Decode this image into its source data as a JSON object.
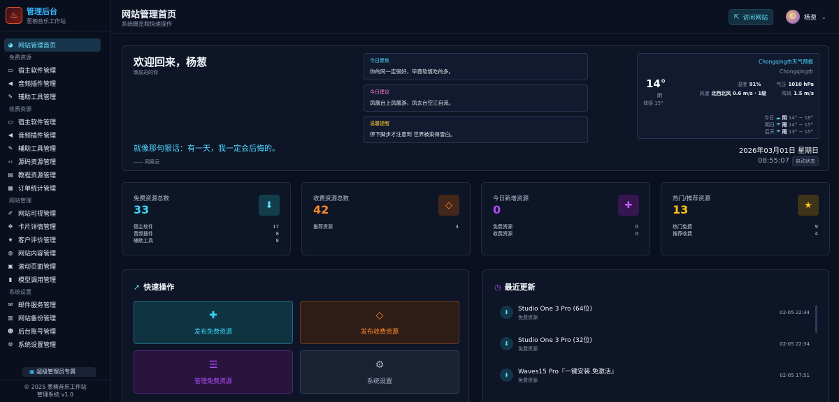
{
  "brand": {
    "title": "管理后台",
    "subtitle": "葱楠音乐工作站"
  },
  "sidebar": {
    "home": "网站管理首页",
    "sections": [
      {
        "label": "免费资源",
        "items": [
          {
            "label": "宿主软件管理",
            "icon": "monitor-icon"
          },
          {
            "label": "音频插件管理",
            "icon": "volume-icon"
          },
          {
            "label": "辅助工具管理",
            "icon": "wrench-icon"
          }
        ]
      },
      {
        "label": "收费资源",
        "items": [
          {
            "label": "宿主软件管理",
            "icon": "monitor-icon"
          },
          {
            "label": "音频插件管理",
            "icon": "volume-icon"
          },
          {
            "label": "辅助工具管理",
            "icon": "wrench-icon"
          },
          {
            "label": "源码资源管理",
            "icon": "code-icon"
          },
          {
            "label": "教程资源管理",
            "icon": "book-icon"
          },
          {
            "label": "订单统计管理",
            "icon": "cart-icon"
          }
        ]
      },
      {
        "label": "网站管理",
        "items": [
          {
            "label": "网站可视管理",
            "icon": "edit-icon"
          },
          {
            "label": "卡片详情管理",
            "icon": "cards-icon"
          },
          {
            "label": "客户评价管理",
            "icon": "star-icon"
          },
          {
            "label": "网站内容管理",
            "icon": "globe-icon"
          },
          {
            "label": "滚动页面管理",
            "icon": "image-icon"
          },
          {
            "label": "模型调用管理",
            "icon": "model-icon"
          }
        ]
      },
      {
        "label": "系统设置",
        "items": [
          {
            "label": "邮件服务管理",
            "icon": "mail-icon"
          },
          {
            "label": "网站备份管理",
            "icon": "backup-icon"
          },
          {
            "label": "后台账号管理",
            "icon": "users-icon"
          },
          {
            "label": "系统设置管理",
            "icon": "gear-icon"
          }
        ]
      }
    ],
    "admin_badge": "超级管理员专属",
    "footer_line1": "© 2025 葱楠音乐工作站",
    "footer_line2": "管理系统 v1.0"
  },
  "topbar": {
    "title": "网站管理首页",
    "subtitle": "系统概览和快速操作",
    "visit_label": "访问网站",
    "user_name": "杨葱"
  },
  "welcome": {
    "title": "欢迎回来，杨葱",
    "subtitle": "致前进的你",
    "quote": "就像那句狠话：有一天，我一定会后悔的。",
    "quote_source": "—— 网易云"
  },
  "tips": [
    {
      "title": "今日聚焦",
      "body": "你的同一定很好，毕竟软饭吃的多。"
    },
    {
      "title": "今日建议",
      "body": "凤凰台上凤凰游，凤去台空江自流。"
    },
    {
      "title": "温馨提醒",
      "body": "停下脚步才注意到 世界被染得雪白。"
    }
  ],
  "weather": {
    "header": "Chongqing市天气预报",
    "city": "Chongqing市",
    "temp": "14°",
    "condition": "阴",
    "feels": "体感 15°",
    "humidity_label": "湿度",
    "humidity": "91%",
    "pressure_label": "气压",
    "pressure": "1010 hPa",
    "wind_label": "风速",
    "wind": "北西北风 0.6 m/s · 1级",
    "gust_label": "阵风",
    "gust": "1.5 m/s",
    "forecast": [
      {
        "day": "今日",
        "cond": "阴",
        "range": "14° ~ 16°"
      },
      {
        "day": "明日",
        "cond": "雨",
        "range": "14° ~ 15°"
      },
      {
        "day": "后天",
        "cond": "雨",
        "range": "13° ~ 15°"
      }
    ]
  },
  "clock": {
    "date": "2026年03月01日 星期日",
    "time": "08:55:07",
    "badge": "启动状态"
  },
  "stats": [
    {
      "label": "免费资源总数",
      "value": "33",
      "color": "#38d5f5",
      "icon_bg": "#123e4c",
      "icon_color": "#5fe0ff",
      "icon": "download-icon",
      "rows": [
        {
          "k": "宿主软件",
          "v": "17"
        },
        {
          "k": "音频插件",
          "v": "8"
        },
        {
          "k": "辅助工具",
          "v": "8"
        }
      ]
    },
    {
      "label": "收费资源总数",
      "value": "42",
      "color": "#ff8a2a",
      "icon_bg": "#43271a",
      "icon_color": "#ff8a2a",
      "icon": "diamond-icon",
      "rows": [
        {
          "k": "推荐资源",
          "v": "4"
        }
      ]
    },
    {
      "label": "今日新增资源",
      "value": "0",
      "color": "#b14cff",
      "icon_bg": "#37164f",
      "icon_color": "#c45cff",
      "icon": "plus-icon",
      "rows": [
        {
          "k": "免费资源",
          "v": "0"
        },
        {
          "k": "收费资源",
          "v": "0"
        }
      ]
    },
    {
      "label": "热门/推荐资源",
      "value": "13",
      "color": "#ffc21a",
      "icon_bg": "#3e3419",
      "icon_color": "#ffc21a",
      "icon": "star-icon",
      "rows": [
        {
          "k": "热门免费",
          "v": "9"
        },
        {
          "k": "推荐收费",
          "v": "4"
        }
      ]
    }
  ],
  "quick": {
    "title": "快速操作",
    "items": [
      {
        "label": "发布免费资源",
        "icon": "plus-icon",
        "bg": "#0f3340",
        "border": "#1f6a80",
        "color": "#38d5f5"
      },
      {
        "label": "发布收费资源",
        "icon": "diamond-icon",
        "bg": "#2e1d17",
        "border": "#6a3a22",
        "color": "#ff8a2a"
      },
      {
        "label": "管理免费资源",
        "icon": "list-icon",
        "bg": "#28143c",
        "border": "#4d2672",
        "color": "#b14cff"
      },
      {
        "label": "系统设置",
        "icon": "gear-icon",
        "bg": "#1a2132",
        "border": "#323d56",
        "color": "#aab4c8"
      }
    ]
  },
  "updates": {
    "title": "最近更新",
    "items": [
      {
        "name": "Studio One 3 Pro (64位)",
        "cat": "免费资源",
        "time": "02-05 22:34"
      },
      {
        "name": "Studio One 3 Pro (32位)",
        "cat": "免费资源",
        "time": "02-05 22:34"
      },
      {
        "name": "Waves15 Pro『一键安装.免激活』",
        "cat": "免费资源",
        "time": "02-05 17:51"
      }
    ]
  }
}
